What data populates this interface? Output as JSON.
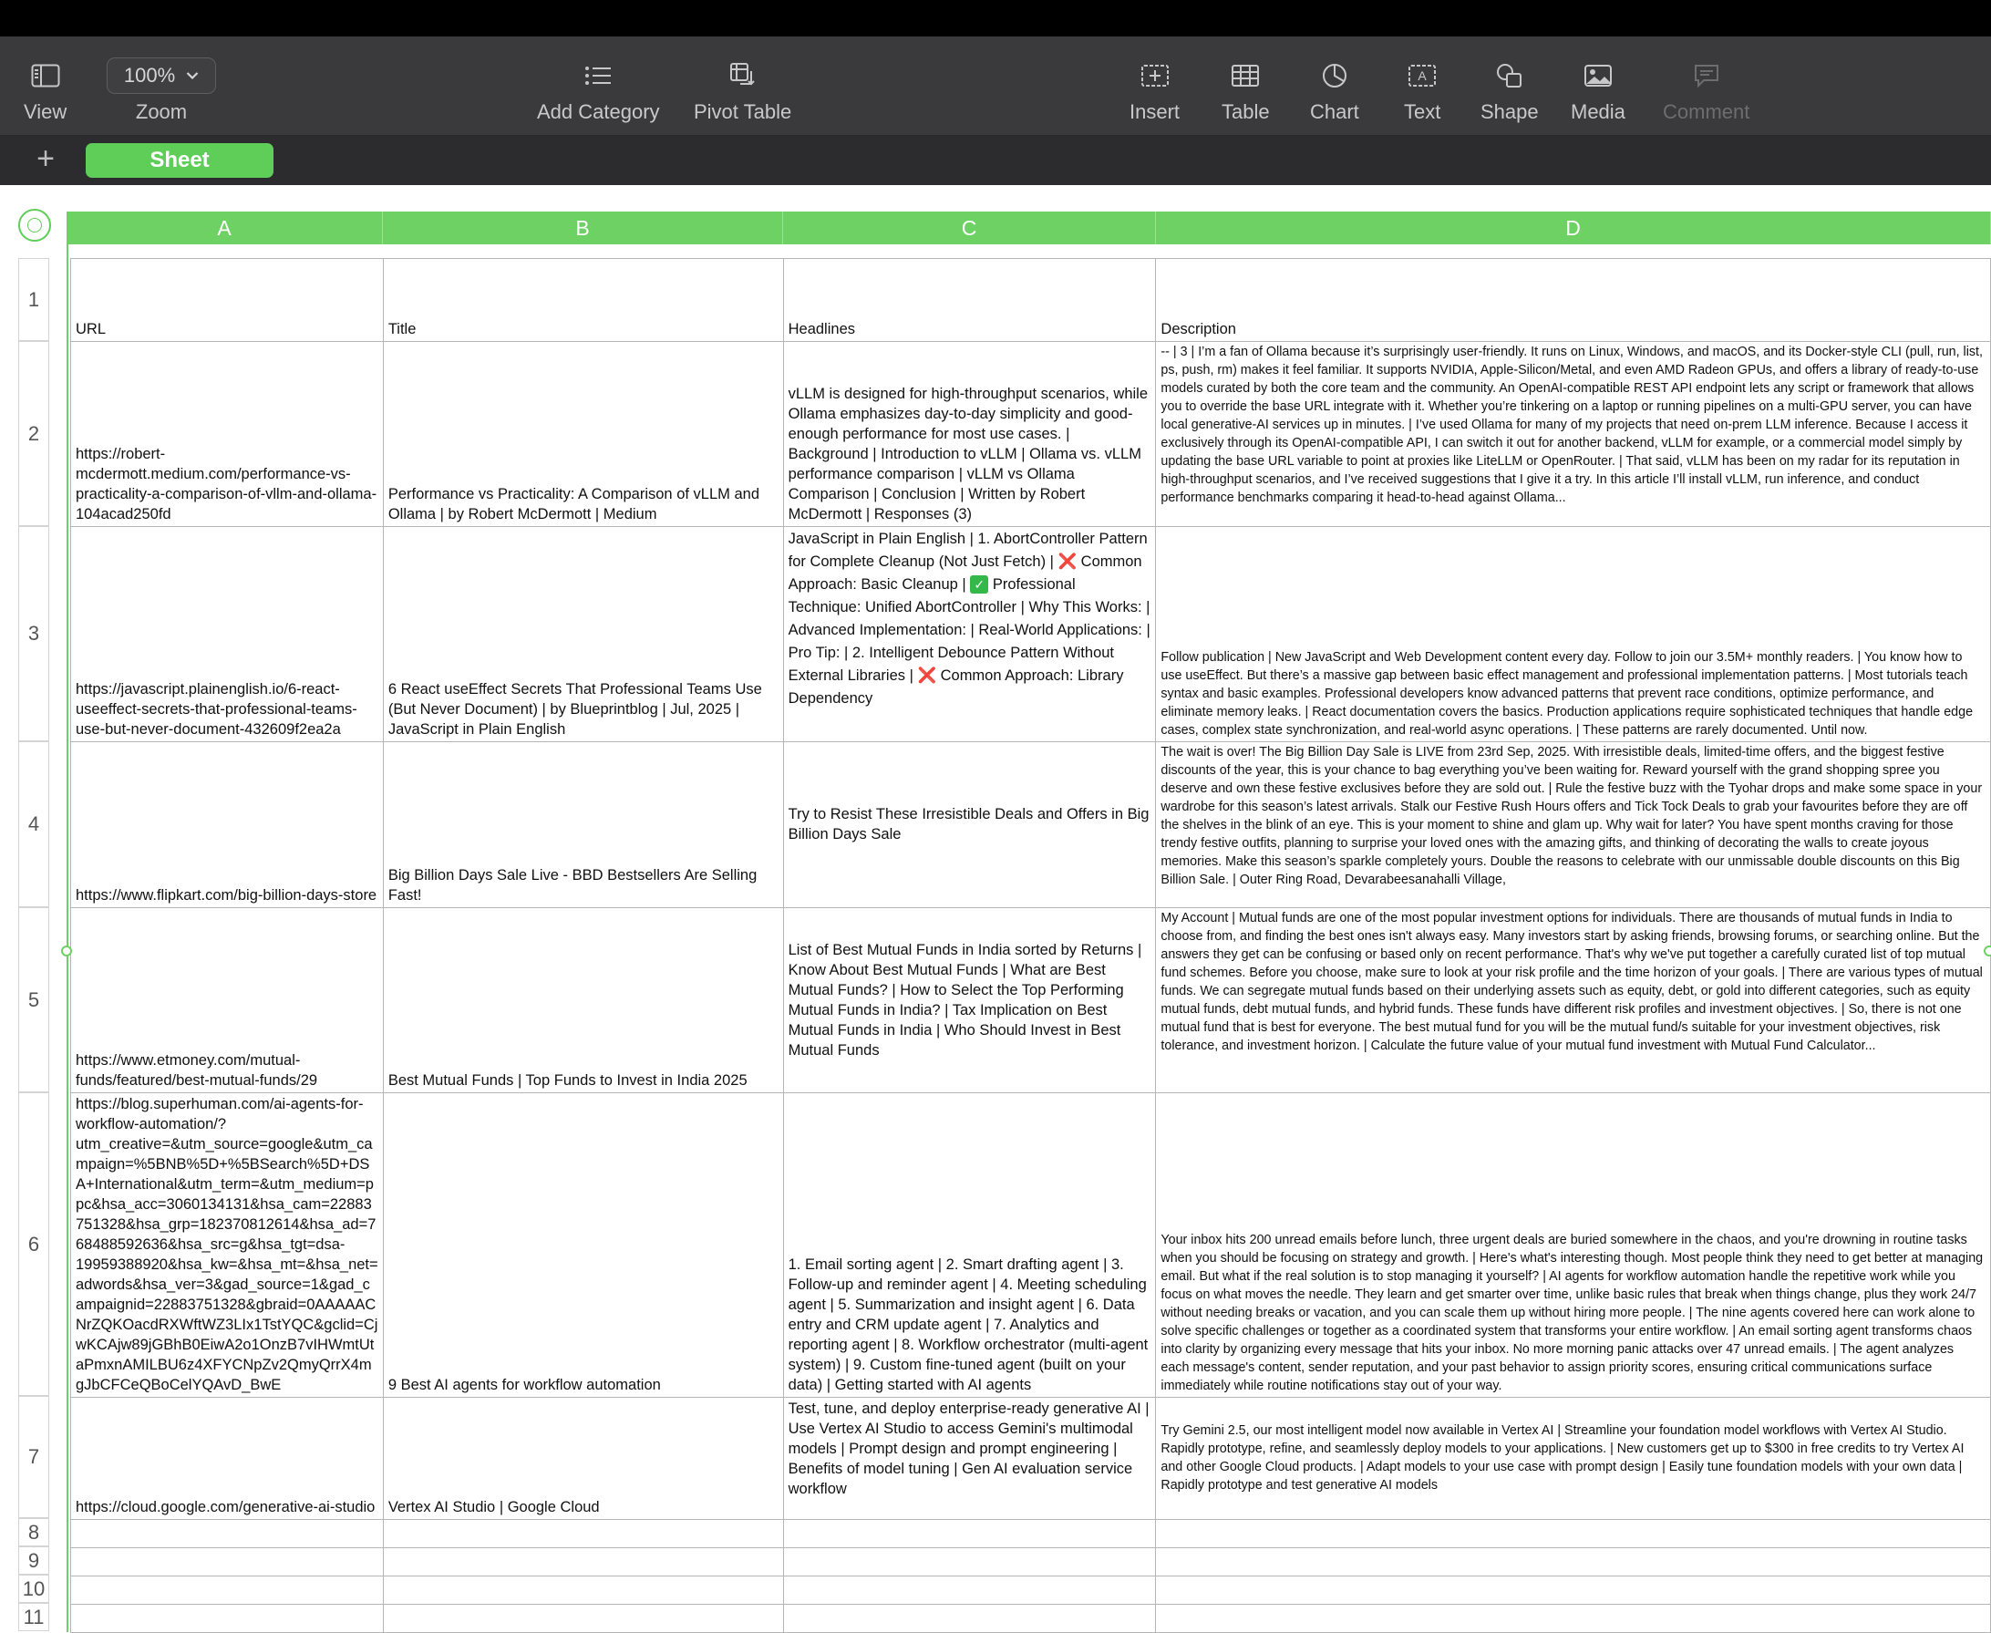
{
  "toolbar": {
    "view": "View",
    "zoom_value": "100%",
    "zoom": "Zoom",
    "add_category": "Add Category",
    "pivot_table": "Pivot Table",
    "insert": "Insert",
    "table": "Table",
    "chart": "Chart",
    "text": "Text",
    "shape": "Shape",
    "media": "Media",
    "comment": "Comment"
  },
  "tabs": {
    "sheet": "Sheet"
  },
  "columns": [
    "A",
    "B",
    "C",
    "D"
  ],
  "row_numbers": [
    "1",
    "2",
    "3",
    "4",
    "5",
    "6",
    "7",
    "8",
    "9",
    "10",
    "11"
  ],
  "headers": {
    "a": "URL",
    "b": "Title",
    "c": "Headlines",
    "d": "Description"
  },
  "rows": [
    {
      "url": "https://robert-mcdermott.medium.com/performance-vs-practicality-a-comparison-of-vllm-and-ollama-104acad250fd",
      "title": "Performance vs Practicality: A Comparison of vLLM and Ollama | by Robert McDermott | Medium",
      "headlines": "vLLM is designed for high-throughput scenarios, while Ollama emphasizes day-to-day simplicity and good-enough performance for most use cases. | Background | Introduction to vLLM | Ollama vs. vLLM performance comparison | vLLM vs Ollama Comparison | Conclusion | Written by Robert McDermott | Responses (3)",
      "description": "-- | 3 | I’m a fan of Ollama because it’s surprisingly user-friendly. It runs on Linux, Windows, and macOS, and its Docker-style CLI (pull, run, list, ps, push, rm) makes it feel familiar. It supports NVIDIA, Apple-Silicon/Metal, and even AMD Radeon GPUs, and offers a library of ready-to-use models curated by both the core team and the community. An OpenAI-compatible REST API endpoint lets any script or framework that allows you to override the base URL integrate with it. Whether you’re tinkering on a laptop or running pipelines on a multi-GPU server, you can have local generative-AI services up in minutes. | I’ve used Ollama for many of my projects that need on-prem LLM inference. Because I access it exclusively through its OpenAI-compatible API, I can switch it out for another backend, vLLM for example, or a commercial model simply by updating the base URL variable to point at proxies like LiteLLM or OpenRouter. | That said, vLLM has been on my radar for its reputation in high-throughput scenarios, and I’ve received suggestions that I give it a try. In this article I’ll install vLLM, run inference, and conduct performance benchmarks comparing it head-to-head against Ollama..."
    },
    {
      "url": "https://javascript.plainenglish.io/6-react-useeffect-secrets-that-professional-teams-use-but-never-document-432609f2ea2a",
      "title": "6 React useEffect Secrets That Professional Teams Use (But Never Document) | by Blueprintblog | Jul, 2025 | JavaScript in Plain English",
      "headlines_parts": {
        "p1": "JavaScript in Plain English | 1. AbortController Pattern for Complete Cleanup (Not Just Fetch) | ",
        "x1": "❌",
        "p2": " Common Approach: Basic Cleanup | ",
        "check": "✓",
        "p3": " Professional Technique: Unified AbortController | Why This Works: | Advanced Implementation: | Real-World Applications: | Pro Tip: | 2. Intelligent Debounce Pattern Without External Libraries | ",
        "x2": "❌",
        "p4": " Common Approach: Library Dependency"
      },
      "description": "Follow publication | New JavaScript and Web Development content every day. Follow to join our 3.5M+ monthly readers. | You know how to use useEffect. But there’s a massive gap between basic effect management and professional implementation patterns. | Most tutorials teach syntax and basic examples. Professional developers know advanced patterns that prevent race conditions, optimize performance, and eliminate memory leaks. | React documentation covers the basics. Production applications require sophisticated techniques that handle edge cases, complex state synchronization, and real-world async operations. | These patterns are rarely documented. Until now."
    },
    {
      "url": "https://www.flipkart.com/big-billion-days-store",
      "title": "Big Billion Days Sale Live - BBD Bestsellers Are Selling Fast!",
      "headlines": "Try to Resist These Irresistible Deals and Offers in Big Billion Days Sale",
      "description": "The wait is over! The Big Billion Day Sale is LIVE from 23rd Sep, 2025. With irresistible deals, limited-time offers, and the biggest festive discounts of the year, this is your chance to bag everything you’ve been waiting for. Reward yourself with the grand shopping spree you deserve and own these festive exclusives before they are sold out. | Rule the festive buzz with the Tyohar drops and make some space in your wardrobe for this season’s latest arrivals. Stalk our Festive Rush Hours offers and Tick Tock Deals to grab your favourites before they are off the shelves in the blink of an eye. This is your moment to shine and glam up. Why wait for later? You have spent months craving for those trendy festive outfits, planning to surprise your loved ones with the amazing gifts, and thinking of decorating the walls to create joyous memories. Make this season’s sparkle completely yours. Double the reasons to celebrate with our unmissable double discounts on this Big Billion Sale. | Outer Ring Road, Devarabeesanahalli Village,"
    },
    {
      "url": "https://www.etmoney.com/mutual-funds/featured/best-mutual-funds/29",
      "title": "Best Mutual Funds | Top Funds to Invest in India 2025",
      "headlines": "List of Best Mutual Funds in India sorted by Returns | Know About Best Mutual Funds | What are Best Mutual Funds? | How to Select the Top Performing Mutual Funds in India? | Tax Implication on Best Mutual Funds in India | Who Should Invest in Best Mutual Funds",
      "description": "My Account | Mutual funds are one of the most popular investment options for individuals. There are thousands of mutual funds in India to choose from, and finding the best ones isn't always easy. Many investors start by asking friends, browsing forums, or searching online. But the answers they get can be confusing or based only on recent performance. That's why we've put together a carefully curated list of top mutual fund schemes. Before you choose, make sure to look at your risk profile and the time horizon of your goals. | There are various types of mutual funds. We can segregate mutual funds based on their underlying assets such as equity, debt, or gold into different categories, such as equity mutual funds, debt mutual funds, and hybrid funds. These funds have different risk profiles and investment objectives. | So, there is not one mutual fund that is best for everyone. The best mutual fund for you will be the mutual fund/s suitable for your investment objectives, risk tolerance, and investment horizon. | Calculate the future value of your mutual fund investment with Mutual Fund Calculator..."
    },
    {
      "url": "https://blog.superhuman.com/ai-agents-for-workflow-automation/?utm_creative=&utm_source=google&utm_campaign=%5BNB%5D+%5BSearch%5D+DSA+International&utm_term=&utm_medium=ppc&hsa_acc=3060134131&hsa_cam=22883751328&hsa_grp=182370812614&hsa_ad=768488592636&hsa_src=g&hsa_tgt=dsa-19959388920&hsa_kw=&hsa_mt=&hsa_net=adwords&hsa_ver=3&gad_source=1&gad_campaignid=22883751328&gbraid=0AAAAACNrZQKOacdRXWftWZ3LIx1TstYQC&gclid=CjwKCAjw89jGBhB0EiwA2o1OnzB7vIHWmtUtaPmxnAMILBU6z4XFYCNpZv2QmyQrrX4mgJbCFCeQBoCelYQAvD_BwE",
      "title": "9 Best AI agents for workflow automation",
      "headlines": "1. Email sorting agent | 2. Smart drafting agent | 3. Follow-up and reminder agent | 4. Meeting scheduling agent | 5. Summarization and insight agent | 6. Data entry and CRM update agent | 7. Analytics and reporting agent | 8. Workflow orchestrator (multi-agent system) | 9. Custom fine-tuned agent (built on your data) | Getting started with AI agents",
      "description": "Your inbox hits 200 unread emails before lunch, three urgent deals are buried somewhere in the chaos, and you're drowning in routine tasks when you should be focusing on strategy and growth. | Here's what's interesting though. Most people think they need to get better at managing email. But what if the real solution is to stop managing it yourself? | AI agents for workflow automation handle the repetitive work while you focus on what moves the needle. They learn and get smarter over time, unlike basic rules that break when things change, plus they work 24/7 without needing breaks or vacation, and you can scale them up without hiring more people. | The nine agents covered here can work alone to solve specific challenges or together as a coordinated system that transforms your entire workflow. | An email sorting agent transforms chaos into clarity by organizing every message that hits your inbox. No more morning panic attacks over 47 unread emails. | The agent analyzes each message's content, sender reputation, and your past behavior to assign priority scores, ensuring critical communications surface immediately while routine notifications stay out of your way."
    },
    {
      "url": "https://cloud.google.com/generative-ai-studio",
      "title": "Vertex AI Studio | Google Cloud",
      "headlines": "Test, tune, and deploy enterprise-ready generative AI | Use Vertex AI Studio to access Gemini's multimodal models | Prompt design and prompt engineering | Benefits of model tuning | Gen AI evaluation service workflow",
      "description": "Try Gemini 2.5, our most intelligent model now available in Vertex AI | Streamline your foundation model workflows with Vertex AI Studio. Rapidly prototype, refine, and seamlessly deploy models to your applications. | New customers get up to $300 in free credits to try Vertex AI and other Google Cloud products. | Adapt models to your use case with prompt design | Easily tune foundation models with your own data | Rapidly prototype and test generative AI models"
    }
  ]
}
